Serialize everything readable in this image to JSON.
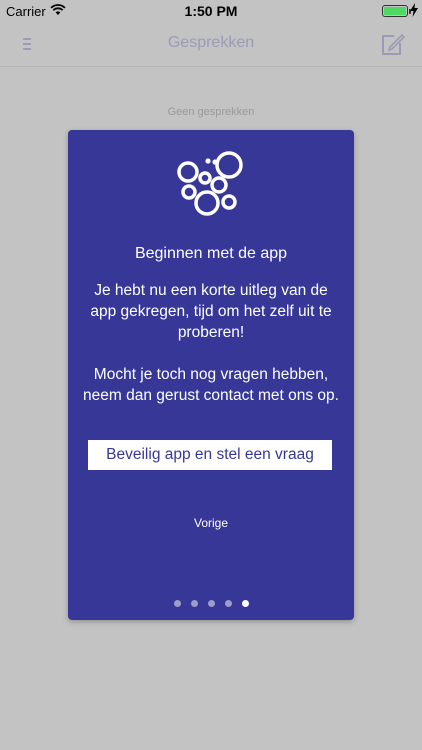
{
  "status_bar": {
    "carrier": "Carrier",
    "time": "1:50 PM",
    "icons": [
      "wifi-icon",
      "battery-icon",
      "charging-bolt-icon"
    ]
  },
  "nav_bar": {
    "title": "Gesprekken",
    "icons": [
      "menu-icon",
      "compose-icon"
    ]
  },
  "list": {
    "empty_text": "Geen gesprekken"
  },
  "modal": {
    "logo_icon": "bubbles-logo-icon",
    "title": "Beginnen met de app",
    "paragraph_1": "Je hebt nu een korte uitleg van de app gekregen, tijd om het zelf uit te proberen!",
    "paragraph_2": "Mocht je toch nog vragen hebben, neem dan gerust contact met ons op.",
    "primary_button": "Beveilig app en stel een vraag",
    "previous_link": "Vorige",
    "pager": {
      "total": 5,
      "current": 5
    }
  },
  "colors": {
    "modal_background": "#373797",
    "overlay": "#c3c3c3",
    "battery": "#4cd964"
  }
}
